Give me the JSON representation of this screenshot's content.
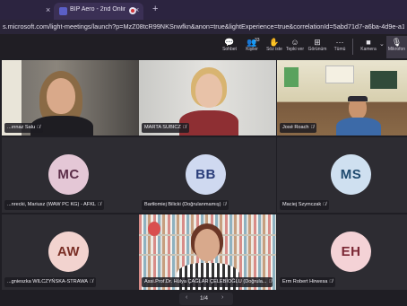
{
  "browser": {
    "tab_title": "BIP Aero - 2nd Online M",
    "url": "s.microsoft.com/light-meetings/launch?p=MzZ08tcR99NKSnwfkn&anon=true&lightExperience=true&correlationId=5abd71d7-a6ba-4d9e-a19e-7b9c7e62",
    "close_glyph": "×",
    "new_tab_glyph": "+"
  },
  "toolbar": {
    "items": [
      {
        "label": "Sohbet",
        "icon": "chat-icon",
        "glyph": "💬"
      },
      {
        "label": "Kişiler",
        "icon": "people-icon",
        "glyph": "👥",
        "count": "33"
      },
      {
        "label": "Söz iste",
        "icon": "raise-hand-icon",
        "glyph": "✋"
      },
      {
        "label": "Tepki ver",
        "icon": "emoji-icon",
        "glyph": "☺"
      },
      {
        "label": "Görünüm",
        "icon": "view-grid-icon",
        "glyph": "⊞"
      },
      {
        "label": "Tümü",
        "icon": "more-icon",
        "glyph": "⋯"
      },
      {
        "label": "Kamera",
        "icon": "camera-icon",
        "glyph": "■"
      },
      {
        "label": "Mikrofon",
        "icon": "mic-icon",
        "glyph": "🎙"
      }
    ],
    "camera_caret": "⌄"
  },
  "participants": [
    {
      "name": "...ınnaz Salu",
      "type": "video",
      "muted": true
    },
    {
      "name": "MARTA SUBICZ",
      "type": "video",
      "muted": true,
      "highlighted": true
    },
    {
      "name": "José Roach",
      "type": "video",
      "muted": true
    },
    {
      "name": "...nrecki, Mariusz (WAW PC KG) - AFKL",
      "initials": "MC",
      "type": "avatar",
      "muted": true,
      "color": "#e4c7d6",
      "text_color": "#5b2d48"
    },
    {
      "name": "Bartłomiej Bilicki (Doğrulanmamış)",
      "initials": "BB",
      "type": "avatar",
      "muted": true,
      "color": "#cfd9f0",
      "text_color": "#2b3e7a"
    },
    {
      "name": "Maciej Szymczak",
      "initials": "MS",
      "type": "avatar",
      "muted": true,
      "color": "#cfe0f0",
      "text_color": "#1f4a6e"
    },
    {
      "name": "...gnieszka WILCZYŃSKA-STRAWA",
      "initials": "AW",
      "type": "avatar",
      "muted": true,
      "color": "#f2d3cf",
      "text_color": "#7a2f26"
    },
    {
      "name": "Assi.Prof.Dr. Hülya ÇAĞLAR ÇELEBİOĞLU (Doğrula...",
      "type": "video",
      "muted": true,
      "highlighted": true
    },
    {
      "name": "Erm Robert Hirwesa",
      "initials": "EH",
      "type": "avatar",
      "muted": true,
      "color": "#f4d2d6",
      "text_color": "#7a2633"
    }
  ],
  "mic_off_glyph": "🎙̸",
  "pager": {
    "text": "1/4",
    "prev": "‹",
    "next": "›"
  }
}
